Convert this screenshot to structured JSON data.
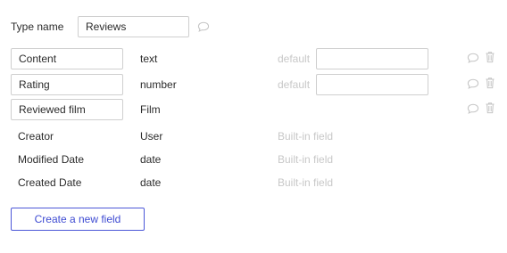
{
  "type_name": {
    "label": "Type name",
    "value": "Reviews"
  },
  "fields": [
    {
      "name": "Content",
      "type": "text",
      "editable": true,
      "default_label": "default",
      "default_value": ""
    },
    {
      "name": "Rating",
      "type": "number",
      "editable": true,
      "default_label": "default",
      "default_value": ""
    },
    {
      "name": "Reviewed film",
      "type": "Film",
      "editable": true
    }
  ],
  "builtin_fields": [
    {
      "name": "Creator",
      "type": "User",
      "note": "Built-in field"
    },
    {
      "name": "Modified Date",
      "type": "date",
      "note": "Built-in field"
    },
    {
      "name": "Created Date",
      "type": "date",
      "note": "Built-in field"
    }
  ],
  "create_button_label": "Create a new field",
  "icons": {
    "comment": "speech-bubble-icon",
    "delete": "trash-icon"
  },
  "colors": {
    "accent": "#3e4bd2",
    "muted_text": "#c8c8c8",
    "icon": "#c4c4c4"
  }
}
